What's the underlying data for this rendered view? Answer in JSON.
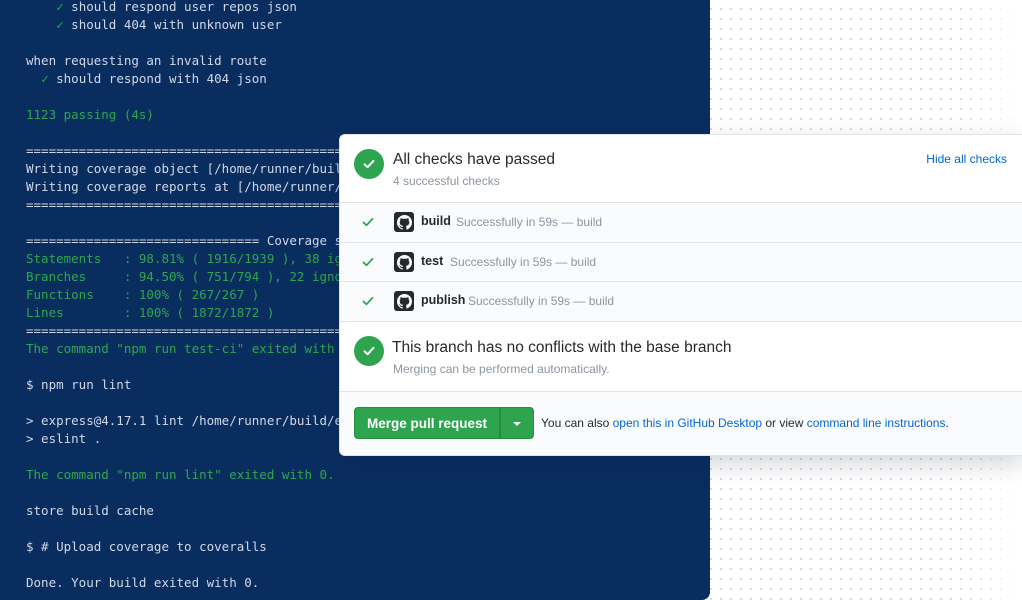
{
  "terminal": {
    "lines": [
      {
        "text": "    ✓ should respond user repos json",
        "style": "normal"
      },
      {
        "text": "    ✓ should 404 with unknown user",
        "style": "normal"
      },
      {
        "text": "",
        "style": "normal"
      },
      {
        "text": "when requesting an invalid route",
        "style": "normal"
      },
      {
        "text": "  ✓ should respond with 404 json",
        "style": "normal"
      },
      {
        "text": "",
        "style": "normal"
      },
      {
        "text": "1123 passing (4s)",
        "style": "green"
      },
      {
        "text": "",
        "style": "normal"
      },
      {
        "text": "=====================================================",
        "style": "normal"
      },
      {
        "text": "Writing coverage object [/home/runner/build/",
        "style": "normal"
      },
      {
        "text": "Writing coverage reports at [/home/runner/bu",
        "style": "normal"
      },
      {
        "text": "=====================================================",
        "style": "normal"
      },
      {
        "text": "",
        "style": "normal"
      },
      {
        "text": "=============================== Coverage su",
        "style": "normal"
      },
      {
        "text": "Statements   : 98.81% ( 1916/1939 ), 38 ign",
        "style": "green"
      },
      {
        "text": "Branches     : 94.50% ( 751/794 ), 22 ignor",
        "style": "green"
      },
      {
        "text": "Functions    : 100% ( 267/267 )",
        "style": "green"
      },
      {
        "text": "Lines        : 100% ( 1872/1872 )",
        "style": "green"
      },
      {
        "text": "=====================================================",
        "style": "normal"
      },
      {
        "text": "The command \"npm run test-ci\" exited with 0",
        "style": "green"
      },
      {
        "text": "",
        "style": "normal"
      },
      {
        "text": "$ npm run lint",
        "style": "normal"
      },
      {
        "text": "",
        "style": "normal"
      },
      {
        "text": "> express@4.17.1 lint /home/runner/build/ex",
        "style": "normal"
      },
      {
        "text": "> eslint .",
        "style": "normal"
      },
      {
        "text": "",
        "style": "normal"
      },
      {
        "text": "The command \"npm run lint\" exited with 0.",
        "style": "green"
      },
      {
        "text": "",
        "style": "normal"
      },
      {
        "text": "store build cache",
        "style": "normal"
      },
      {
        "text": "",
        "style": "normal"
      },
      {
        "text": "$ # Upload coverage to coveralls",
        "style": "normal"
      },
      {
        "text": "",
        "style": "normal"
      },
      {
        "text": "Done. Your build exited with 0.",
        "style": "normal"
      }
    ]
  },
  "panel": {
    "checks_title": "All checks have passed",
    "checks_subtitle": "4 successful checks",
    "hide_link": "Hide all checks",
    "checks": [
      {
        "name": "build",
        "status": "Successfully in 59s — build"
      },
      {
        "name": "test",
        "status": "Successfully in 59s — build"
      },
      {
        "name": "publish",
        "status": "Successfully in 59s — build"
      }
    ],
    "conflict_title": "This branch has no conflicts with the base branch",
    "conflict_subtitle": "Merging can be performed automatically.",
    "merge_button": "Merge pull request",
    "merge_text_prefix": "You can also ",
    "desktop_link": "open this in GitHub Desktop",
    "merge_text_mid": " or view ",
    "cli_link": "command line instructions",
    "merge_text_suffix": "."
  },
  "colors": {
    "terminal_bg": "#0a2d60",
    "success_green": "#2ea44f",
    "link_blue": "#0366d6"
  }
}
